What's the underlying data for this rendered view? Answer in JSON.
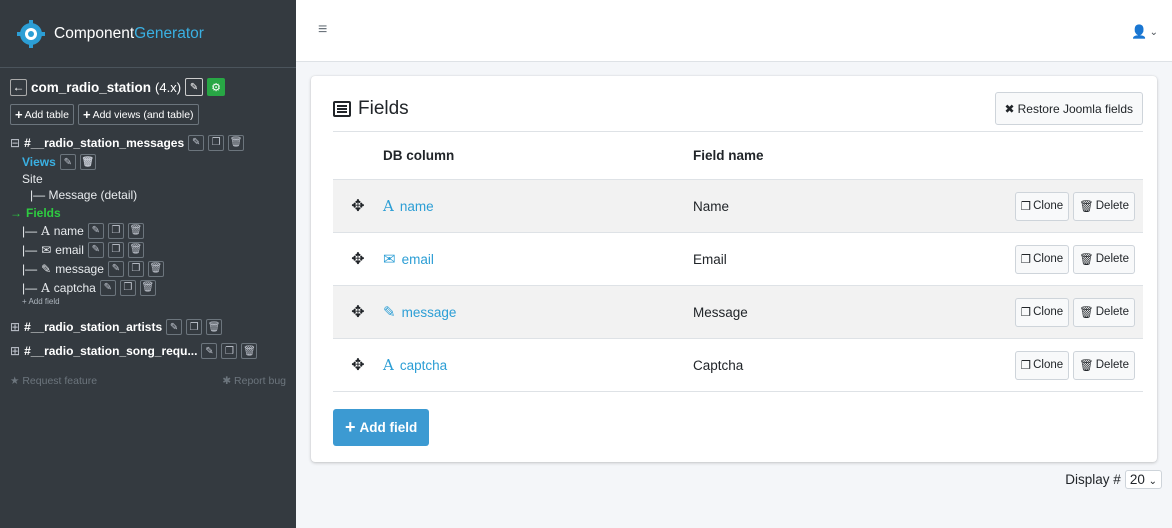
{
  "brand": {
    "part1": "Component",
    "part2": "Generator"
  },
  "sidebar": {
    "component": {
      "name": "com_radio_station",
      "version": "(4.x)"
    },
    "add_table": "Add table",
    "add_views": "Add views (and table)",
    "tables": [
      {
        "name": "#__radio_station_messages",
        "expand": "⊟"
      },
      {
        "name": "#__radio_station_artists",
        "expand": "⊞"
      },
      {
        "name": "#__radio_station_song_requ...",
        "expand": "⊞"
      }
    ],
    "views_label": "Views",
    "site_label": "Site",
    "view_item": "|— Message (detail)",
    "fields_label": "Fields",
    "fields": [
      {
        "prefix": "|—",
        "icon": "A",
        "name": "name"
      },
      {
        "prefix": "|—",
        "icon": "✉",
        "name": "email"
      },
      {
        "prefix": "|—",
        "icon": "✎",
        "name": "message"
      },
      {
        "prefix": "|—",
        "icon": "A",
        "name": "captcha"
      }
    ],
    "add_field_small": "Add field",
    "request_feature": "Request feature",
    "report_bug": "Report bug"
  },
  "main": {
    "title": "Fields",
    "restore_label": "Restore Joomla fields",
    "columns": {
      "db": "DB column",
      "field": "Field name"
    },
    "rows": [
      {
        "icon": "A",
        "db": "name",
        "field": "Name"
      },
      {
        "icon": "✉",
        "db": "email",
        "field": "Email"
      },
      {
        "icon": "✎",
        "db": "message",
        "field": "Message"
      },
      {
        "icon": "A",
        "db": "captcha",
        "field": "Captcha"
      }
    ],
    "clone_label": "Clone",
    "delete_label": "Delete",
    "add_field_label": "Add field",
    "display_label": "Display #",
    "display_value": "20"
  }
}
